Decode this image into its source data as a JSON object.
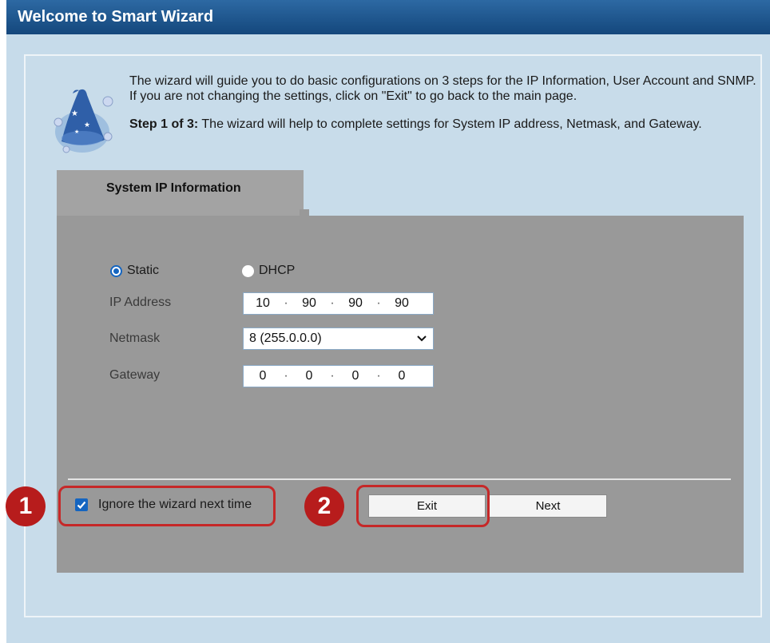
{
  "window": {
    "title": "Welcome to Smart Wizard"
  },
  "intro": {
    "text": "The wizard will guide you to do basic configurations on 3 steps for the IP Information, User Account and SNMP. If you are not changing the settings, click on \"Exit\" to go back to the main page.",
    "step_label": "Step 1 of 3:",
    "step_text": " The wizard will help to complete settings for System IP address, Netmask, and Gateway."
  },
  "tab": {
    "label": "System IP Information"
  },
  "form": {
    "static_label": "Static",
    "dhcp_label": "DHCP",
    "mode_selected": "Static",
    "ip_label": "IP Address",
    "ip_octets": [
      "10",
      "90",
      "90",
      "90"
    ],
    "netmask_label": "Netmask",
    "netmask_value": "8 (255.0.0.0)",
    "gateway_label": "Gateway",
    "gateway_octets": [
      "0",
      "0",
      "0",
      "0"
    ]
  },
  "footer": {
    "ignore_label": "Ignore the wizard next time",
    "ignore_checked": true,
    "exit_label": "Exit",
    "next_label": "Next"
  },
  "annotations": {
    "badge1": "1",
    "badge2": "2",
    "highlight_color": "#c62828"
  },
  "colors": {
    "titlebar": "#1f5a93",
    "background": "#c6dbea",
    "content": "#999999",
    "accent": "#1565c0"
  }
}
